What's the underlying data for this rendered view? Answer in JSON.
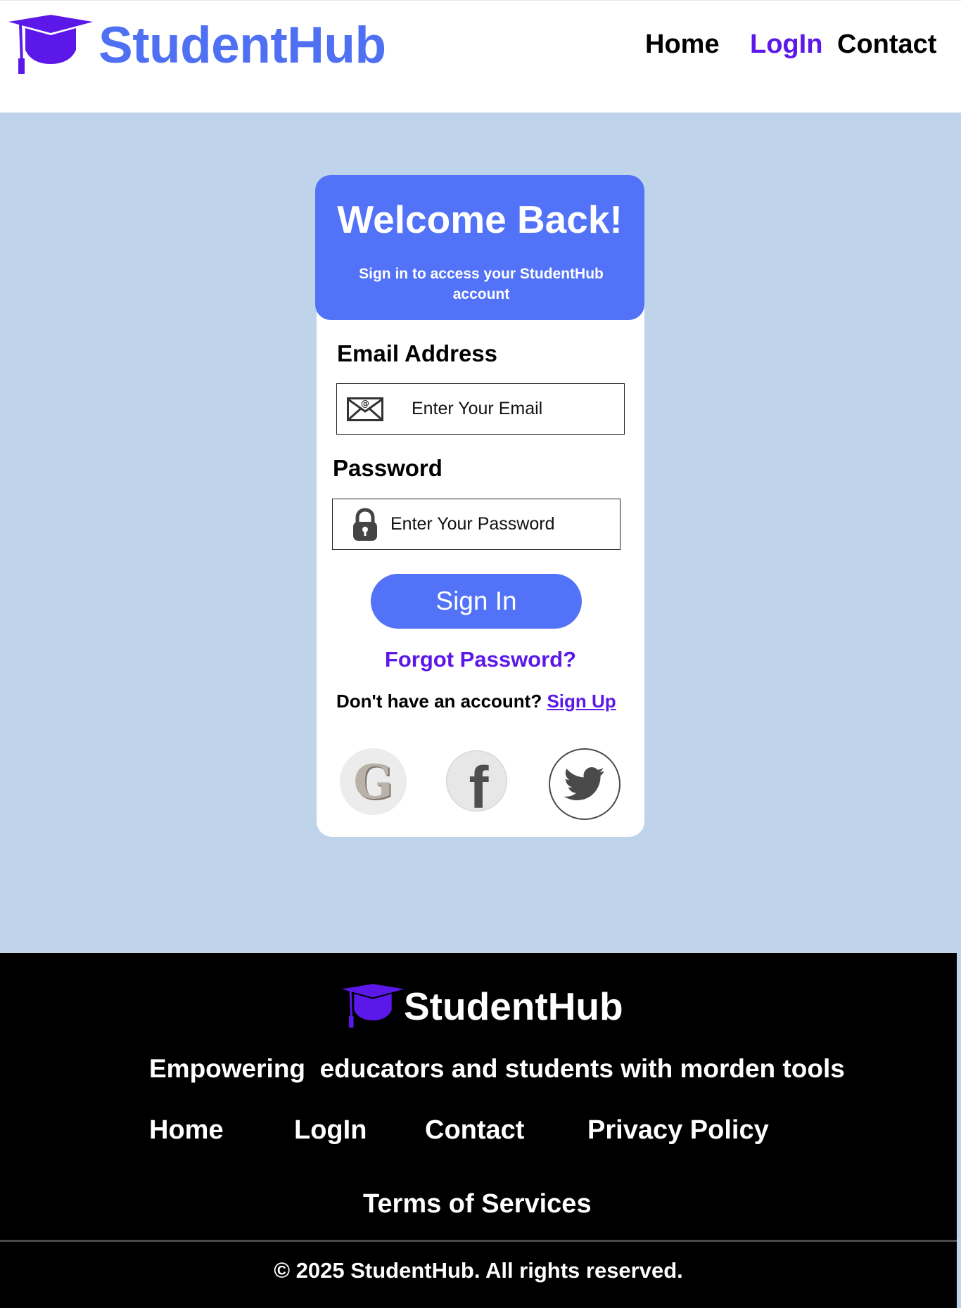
{
  "header": {
    "brand": "StudentHub",
    "nav": {
      "home": "Home",
      "login": "LogIn",
      "contact": "Contact"
    },
    "active_nav": "LogIn"
  },
  "login_card": {
    "title": "Welcome Back!",
    "subtitle": "Sign in to access your StudentHub account",
    "email_label": "Email Address",
    "email_placeholder": "Enter Your Email",
    "email_icon": "mail-icon",
    "password_label": "Password",
    "password_placeholder": "Enter Your Password",
    "password_icon": "lock-icon",
    "signin_label": "Sign In",
    "forgot_label": "Forgot Password?",
    "no_account_text": "Don't have an account?",
    "signup_label": "Sign Up",
    "social": [
      {
        "name": "google",
        "glyph": "G"
      },
      {
        "name": "facebook",
        "glyph": "f"
      },
      {
        "name": "twitter",
        "icon": "twitter-bird-icon"
      }
    ]
  },
  "footer": {
    "brand": "StudentHub",
    "tagline": "Empowering  educators and students with morden tools",
    "links": {
      "home": "Home",
      "login": "LogIn",
      "contact": "Contact",
      "privacy": "Privacy Policy",
      "terms": "Terms of Services"
    },
    "copyright": "© 2025 StudentHub. All rights reserved."
  },
  "colors": {
    "accent_blue": "#5272f7",
    "accent_purple": "#5b18e8",
    "page_bg": "#bfd4eb",
    "footer_bg": "#000000"
  }
}
